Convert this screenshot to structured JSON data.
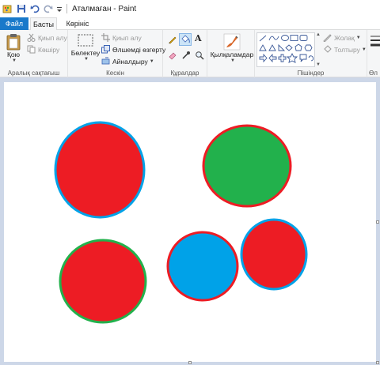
{
  "titlebar": {
    "title": "Аталмаған - Paint"
  },
  "tabs": {
    "file": "Файл",
    "home": "Басты",
    "view": "Көрініс"
  },
  "clipboard": {
    "paste": "Қою",
    "cut": "Қиып алу",
    "copy": "Көшіру",
    "label": "Аралық сақтағыш"
  },
  "image": {
    "select": "Бөлектеу",
    "crop": "Қиып алу",
    "resize": "Өлшемді өзгерту",
    "rotate": "Айналдыру",
    "label": "Кескін"
  },
  "tools": {
    "text_icon": "A",
    "label": "Құралдар"
  },
  "brushes": {
    "label": "Қылқаламдар"
  },
  "shapes": {
    "outline": "Жолақ",
    "fill": "Толтыру",
    "label": "Пішіндер"
  },
  "size": {
    "label": "Өл"
  },
  "colors": {
    "red": "#ed1c24",
    "green": "#22b14c",
    "blue": "#00a2e8",
    "accent": "#1979ca"
  },
  "canvas": {
    "shapes": [
      {
        "name": "red-circle-blue-outline",
        "fill": "#ed1c24",
        "stroke": "#00a2e8"
      },
      {
        "name": "green-circle-red-outline",
        "fill": "#22b14c",
        "stroke": "#ed1c24"
      },
      {
        "name": "red-circle-green-outline",
        "fill": "#ed1c24",
        "stroke": "#22b14c"
      },
      {
        "name": "blue-circle-red-outline",
        "fill": "#00a2e8",
        "stroke": "#ed1c24"
      },
      {
        "name": "red-circle-blue-outline-small",
        "fill": "#ed1c24",
        "stroke": "#00a2e8"
      }
    ]
  }
}
